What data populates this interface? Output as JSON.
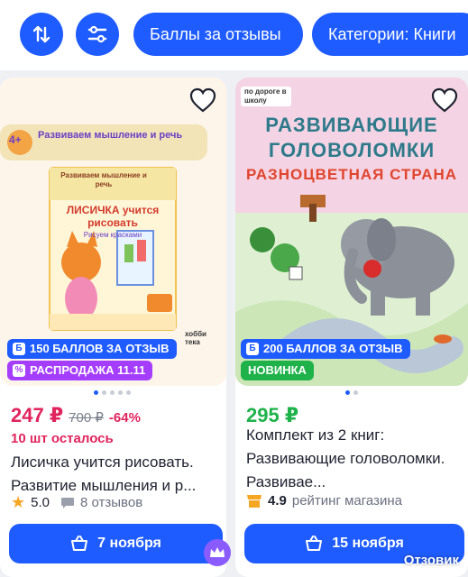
{
  "topbar": {
    "sort_icon": "sort-arrows-icon",
    "filter_icon": "filter-sliders-icon",
    "chips": [
      "Баллы за отзывы",
      "Категории: Книги"
    ]
  },
  "products": [
    {
      "cover": {
        "age_banner": "Развиваем мышление и речь",
        "age": "4+",
        "book_series": "Развиваем мышление и речь",
        "book_title": "ЛИСИЧКА учится рисовать",
        "book_subtitle": "Рисуем красками",
        "publisher": "хобби тека"
      },
      "badge_points": "150 БАЛЛОВ ЗА ОТЗЫВ",
      "badge_sale": "РАСПРОДАЖА 11.11",
      "price": "247 ₽",
      "old_price": "700 ₽",
      "discount": "-64%",
      "stock": "10 шт осталось",
      "title": "Лисичка учится рисовать. Развитие мышления и р...",
      "rating": "5.0",
      "reviews": "8 отзывов",
      "delivery": "7 ноября"
    },
    {
      "cover": {
        "corner_label": "по дороге в школу",
        "book_title_line1": "РАЗВИВАЮЩИЕ",
        "book_title_line2": "ГОЛОВОЛОМКИ",
        "book_subtitle": "РАЗНОЦВЕТНАЯ СТРАНА"
      },
      "badge_points": "200 БАЛЛОВ ЗА ОТЗЫВ",
      "badge_new": "НОВИНКА",
      "price": "295 ₽",
      "title": "Комплект из 2 книг: Развивающие головоломки. Развивае...",
      "rating": "4.9",
      "rating_label": "рейтинг магазина",
      "delivery": "15 ноября"
    }
  ],
  "watermark": "Отзовик",
  "colors": {
    "accent": "#1f5cff",
    "price_pink": "#e0245e",
    "price_green": "#1fb24a"
  }
}
